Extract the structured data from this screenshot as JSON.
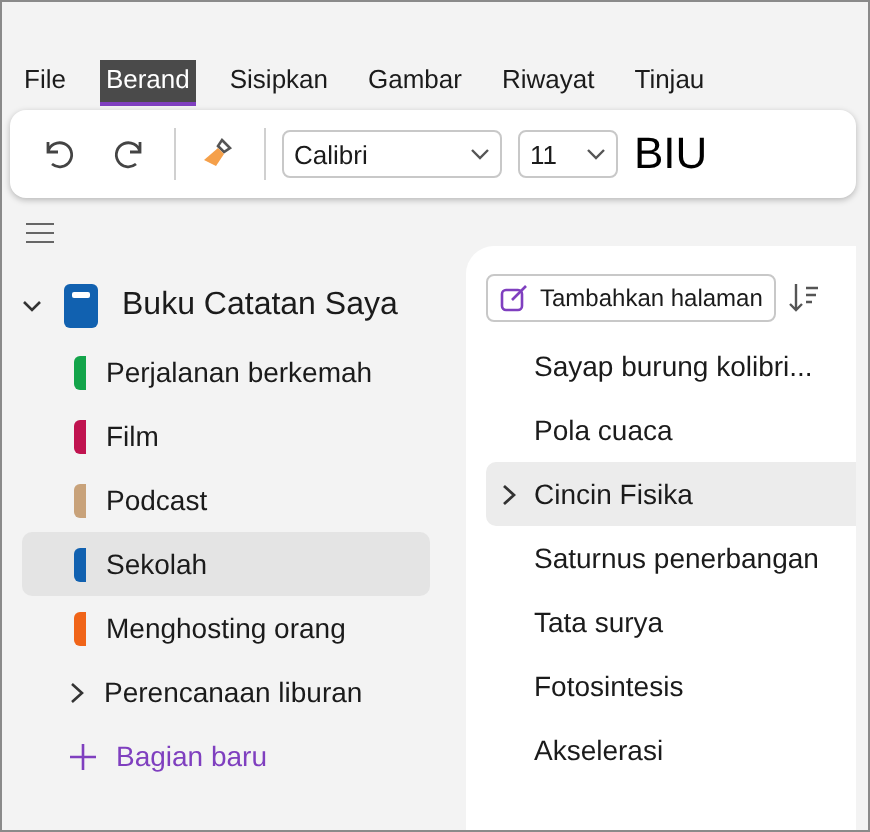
{
  "tabs": [
    {
      "label": "File",
      "selected": false
    },
    {
      "label": "Berand",
      "selected": true
    },
    {
      "label": "Sisipkan",
      "selected": false
    },
    {
      "label": "Gambar",
      "selected": false
    },
    {
      "label": "Riwayat",
      "selected": false
    },
    {
      "label": "Tinjau",
      "selected": false
    }
  ],
  "ribbon": {
    "font": "Calibri",
    "size": "11",
    "format": "BIU"
  },
  "notebook": {
    "name": "Buku Catatan Saya",
    "expanded": true,
    "sections": [
      {
        "label": "Perjalanan berkemah",
        "kind": "section",
        "color": "#13a44a",
        "selected": false
      },
      {
        "label": "Film",
        "kind": "section",
        "color": "#c0134f",
        "selected": false
      },
      {
        "label": "Podcast",
        "kind": "section",
        "color": "#c8a27a",
        "selected": false
      },
      {
        "label": "Sekolah",
        "kind": "section",
        "color": "#1161b0",
        "selected": true
      },
      {
        "label": "Menghosting orang",
        "kind": "section",
        "color": "#f06418",
        "selected": false
      },
      {
        "label": "Perencanaan liburan",
        "kind": "group",
        "expanded": false,
        "selected": false
      },
      {
        "label": "Bagian baru",
        "kind": "new"
      }
    ]
  },
  "pages": {
    "add_label": "Tambahkan halaman",
    "items": [
      {
        "title": "Sayap burung kolibri...",
        "selected": false
      },
      {
        "title": "Pola cuaca",
        "selected": false
      },
      {
        "title": "Cincin Fisika",
        "selected": true,
        "expanded": false
      },
      {
        "title": "Saturnus penerbangan",
        "selected": false
      },
      {
        "title": "Tata surya",
        "selected": false
      },
      {
        "title": "Fotosintesis",
        "selected": false
      },
      {
        "title": "Akselerasi",
        "selected": false
      }
    ]
  }
}
